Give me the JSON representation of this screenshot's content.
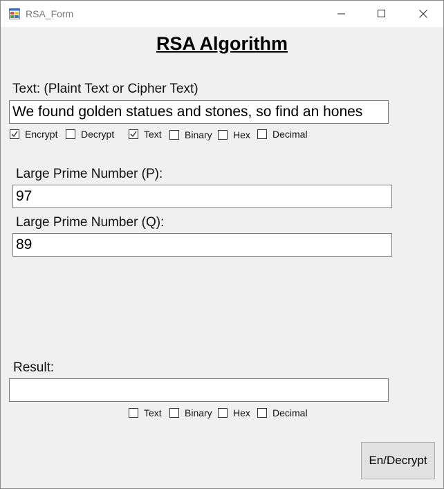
{
  "window": {
    "title": "RSA_Form",
    "icon": "form-icon"
  },
  "heading": "RSA Algorithm",
  "input": {
    "label": "Text: (Plaint Text or Cipher Text)",
    "value": "We found golden statues and stones, so find an hones"
  },
  "input_options": [
    {
      "label": "Encrypt",
      "checked": true
    },
    {
      "label": "Decrypt",
      "checked": false
    },
    {
      "label": "Text",
      "checked": true
    },
    {
      "label": "Binary",
      "checked": false
    },
    {
      "label": "Hex",
      "checked": false
    },
    {
      "label": "Decimal",
      "checked": false
    }
  ],
  "prime_p": {
    "label": "Large Prime Number (P):",
    "value": "97"
  },
  "prime_q": {
    "label": "Large Prime Number (Q):",
    "value": "89"
  },
  "result": {
    "label": "Result:",
    "value": ""
  },
  "result_options": [
    {
      "label": "Text",
      "checked": false
    },
    {
      "label": "Binary",
      "checked": false
    },
    {
      "label": "Hex",
      "checked": false
    },
    {
      "label": "Decimal",
      "checked": false
    }
  ],
  "action_button": "En/Decrypt",
  "colors": {
    "window_bg": "#f0f0f0",
    "titlebar_bg": "#ffffff",
    "button_bg": "#e1e1e1"
  }
}
